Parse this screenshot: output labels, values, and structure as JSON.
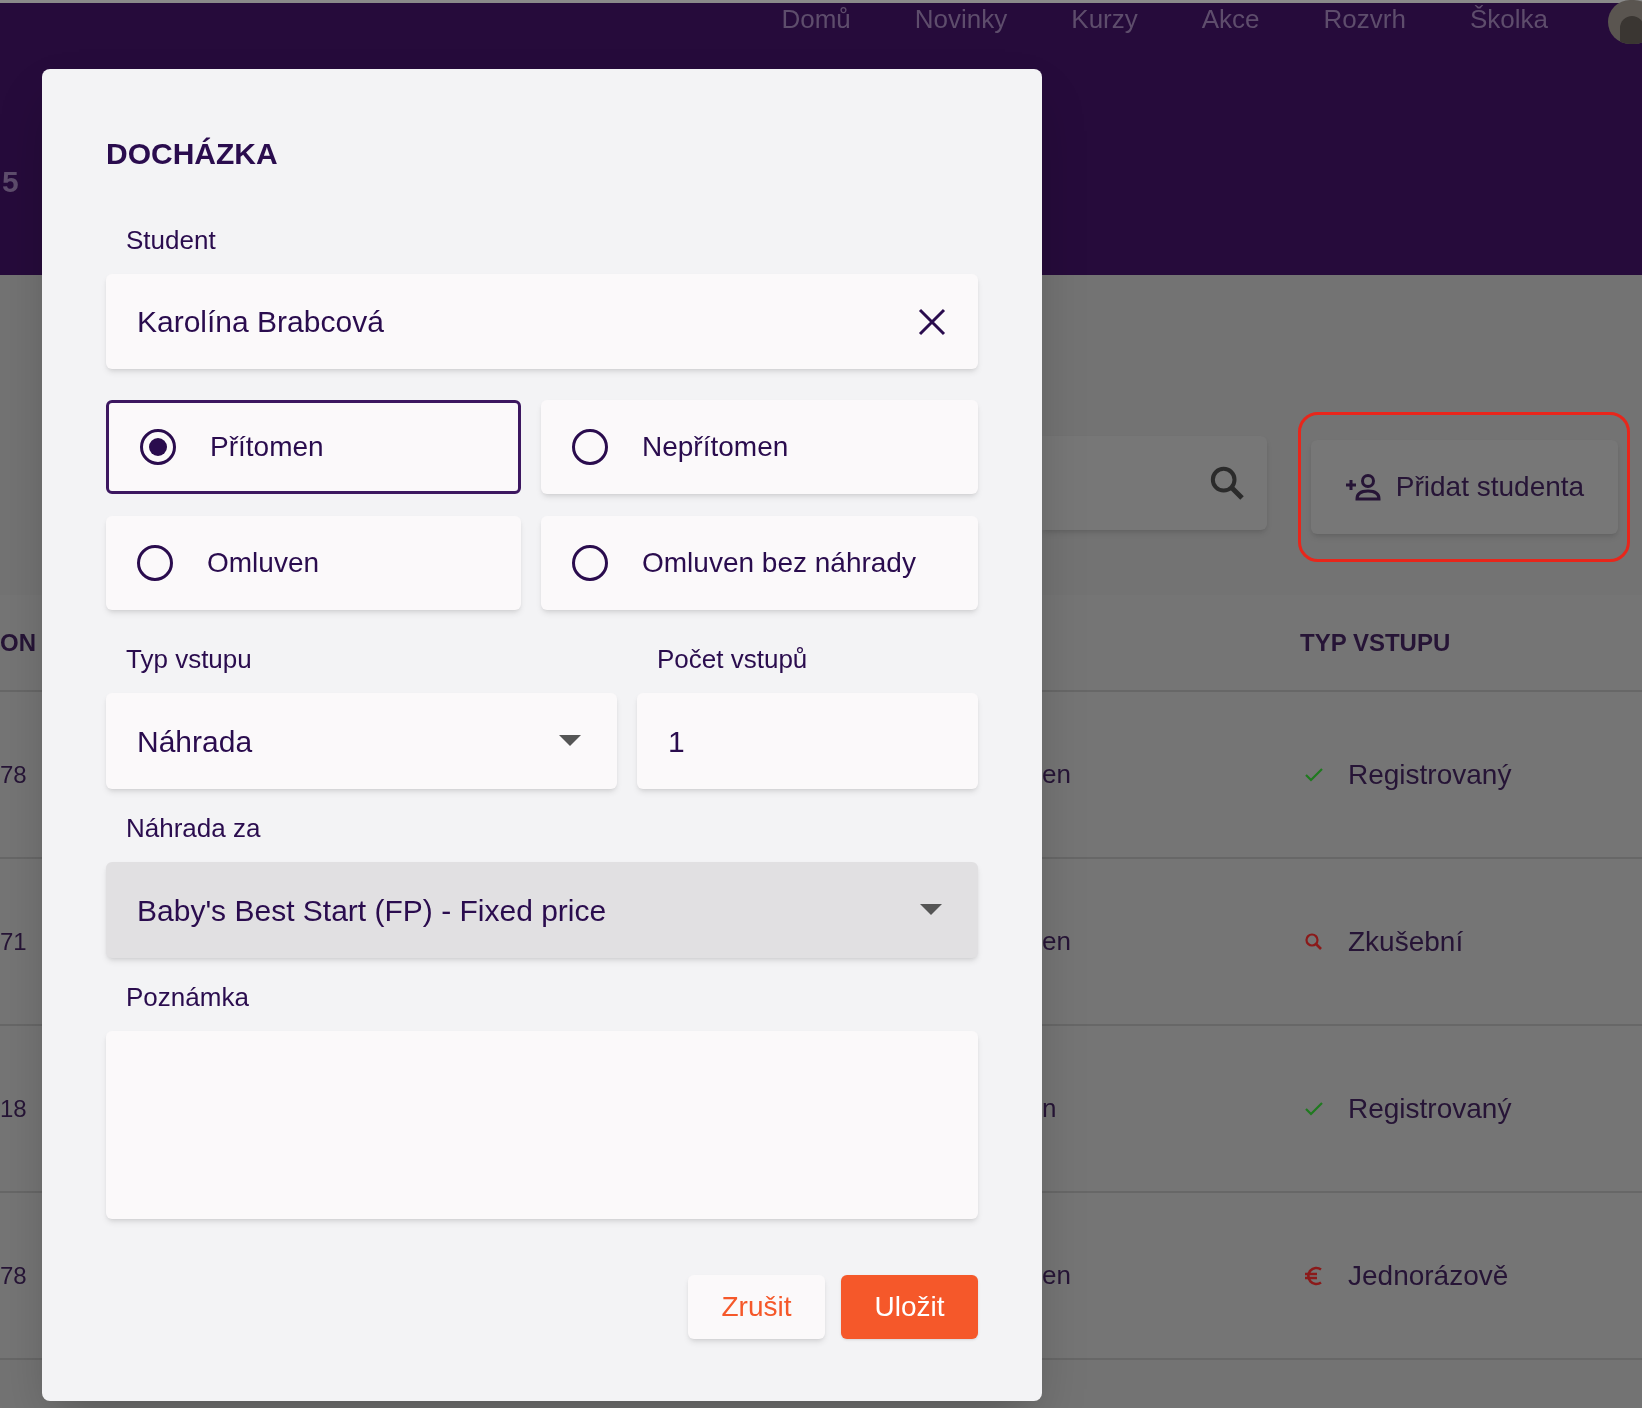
{
  "nav": {
    "items": [
      "Domů",
      "Novinky",
      "Kurzy",
      "Akce",
      "Rozvrh",
      "Školka"
    ]
  },
  "header": {
    "number": "5"
  },
  "toolbar": {
    "add_button": {
      "label": "Přidat studenta",
      "highlighted": true
    }
  },
  "table": {
    "columns": [
      "ON",
      "TYP VSTUPU"
    ],
    "rows": [
      {
        "column_1": "78",
        "column_2": "en",
        "type": "Registrovaný",
        "kind": "registered"
      },
      {
        "column_1": "71",
        "column_2": "en",
        "type": "Zkušební",
        "kind": "trial"
      },
      {
        "column_1": "18",
        "column_2": "n",
        "type": "Registrovaný",
        "kind": "registered"
      },
      {
        "column_1": "78",
        "column_2": "en",
        "type": "Jednorázově",
        "kind": "single"
      }
    ]
  },
  "dialog": {
    "title": "DOCHÁZKA",
    "student": {
      "label": "Student",
      "value": "Karolína Brabcová"
    },
    "attendance": [
      {
        "label": "Přítomen",
        "selected": true
      },
      {
        "label": "Nepřítomen",
        "selected": false
      },
      {
        "label": "Omluven",
        "selected": false
      },
      {
        "label": "Omluven bez náhrady",
        "selected": false
      }
    ],
    "entry_type": {
      "label": "Typ vstupu",
      "value": "Náhrada"
    },
    "entry_count": {
      "label": "Počet vstupů",
      "value": "1"
    },
    "replacement": {
      "label": "Náhrada za",
      "value": "Baby's Best Start (FP) - Fixed price",
      "disabled": true
    },
    "note": {
      "label": "Poznámka"
    },
    "buttons": [
      {
        "label": "Zrušit",
        "kind": "secondary"
      },
      {
        "label": "Uložit",
        "kind": "primary"
      }
    ]
  }
}
